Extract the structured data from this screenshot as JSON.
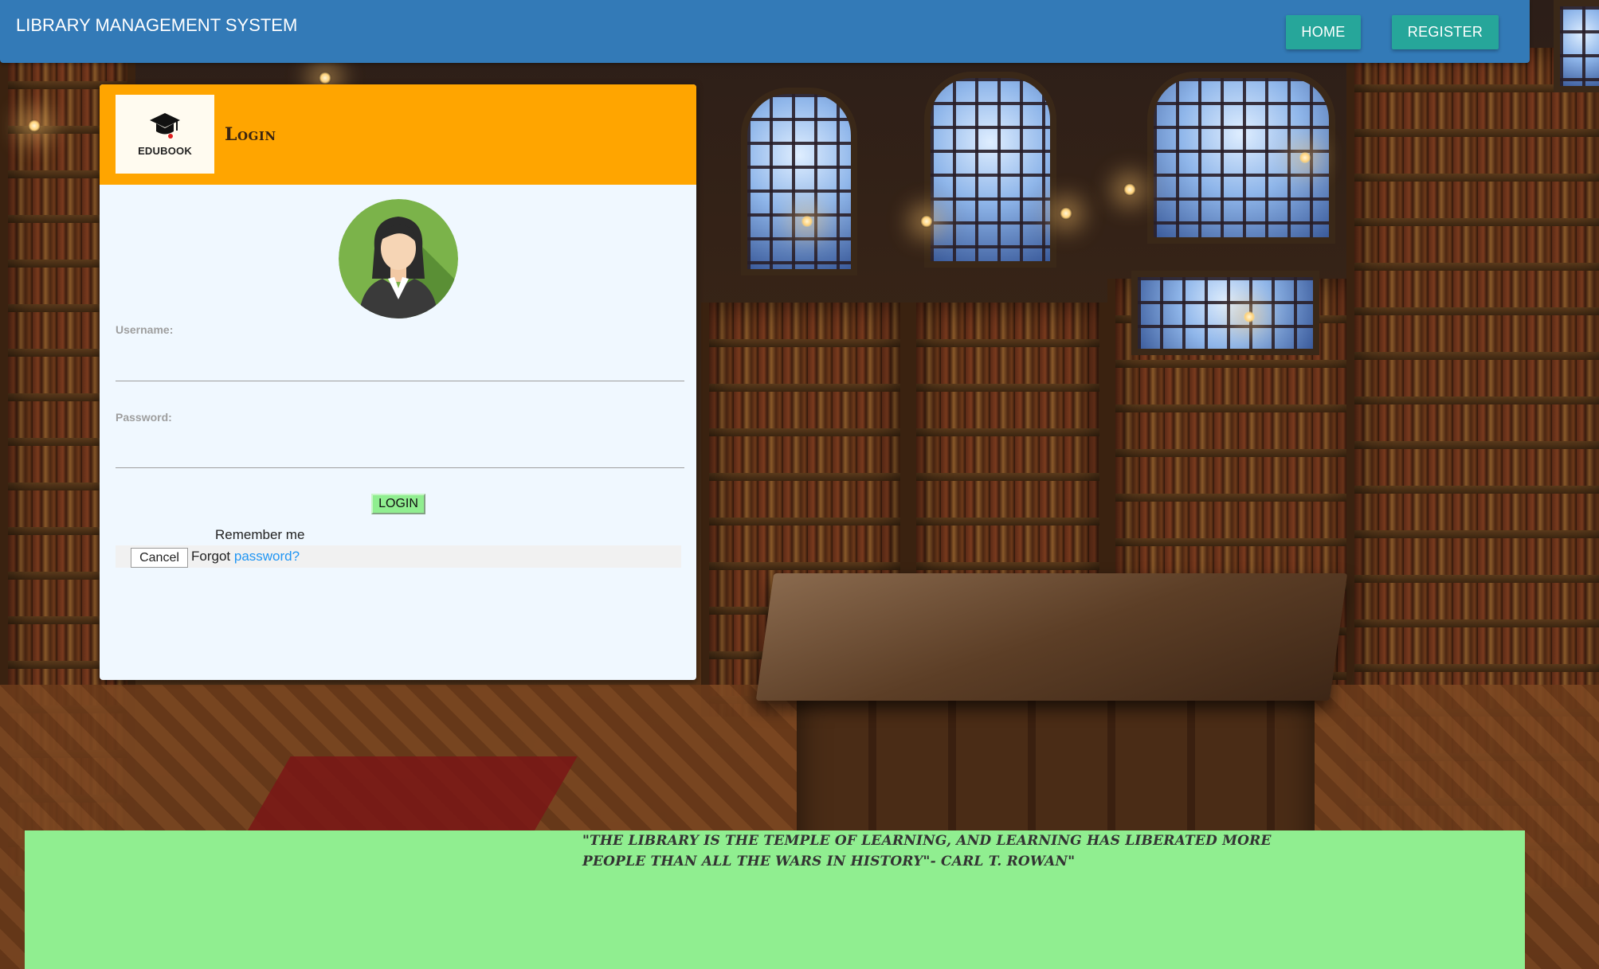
{
  "navbar": {
    "brand": "LIBRARY MANAGEMENT SYSTEM",
    "home_label": "HOME",
    "register_label": "REGISTER",
    "color": "#337ab7",
    "button_color": "#26a69a"
  },
  "login_card": {
    "logo_text": "EDUBOOK",
    "logo_icon": "graduation-cap-icon",
    "title": "Login",
    "header_color": "#ffa500",
    "avatar_icon": "user-avatar-icon",
    "username_label": "Username:",
    "username_value": "",
    "password_label": "Password:",
    "password_value": "",
    "login_button": "LOGIN",
    "remember_me": "Remember me",
    "cancel_button": "Cancel",
    "forgot_text": "Forgot",
    "forgot_link": "password?"
  },
  "quote": {
    "text": "\"The library is the temple of learning, and learning has liberated more people than all the wars in history\"- Carl T. Rowan\"",
    "background": "#90ee90"
  }
}
